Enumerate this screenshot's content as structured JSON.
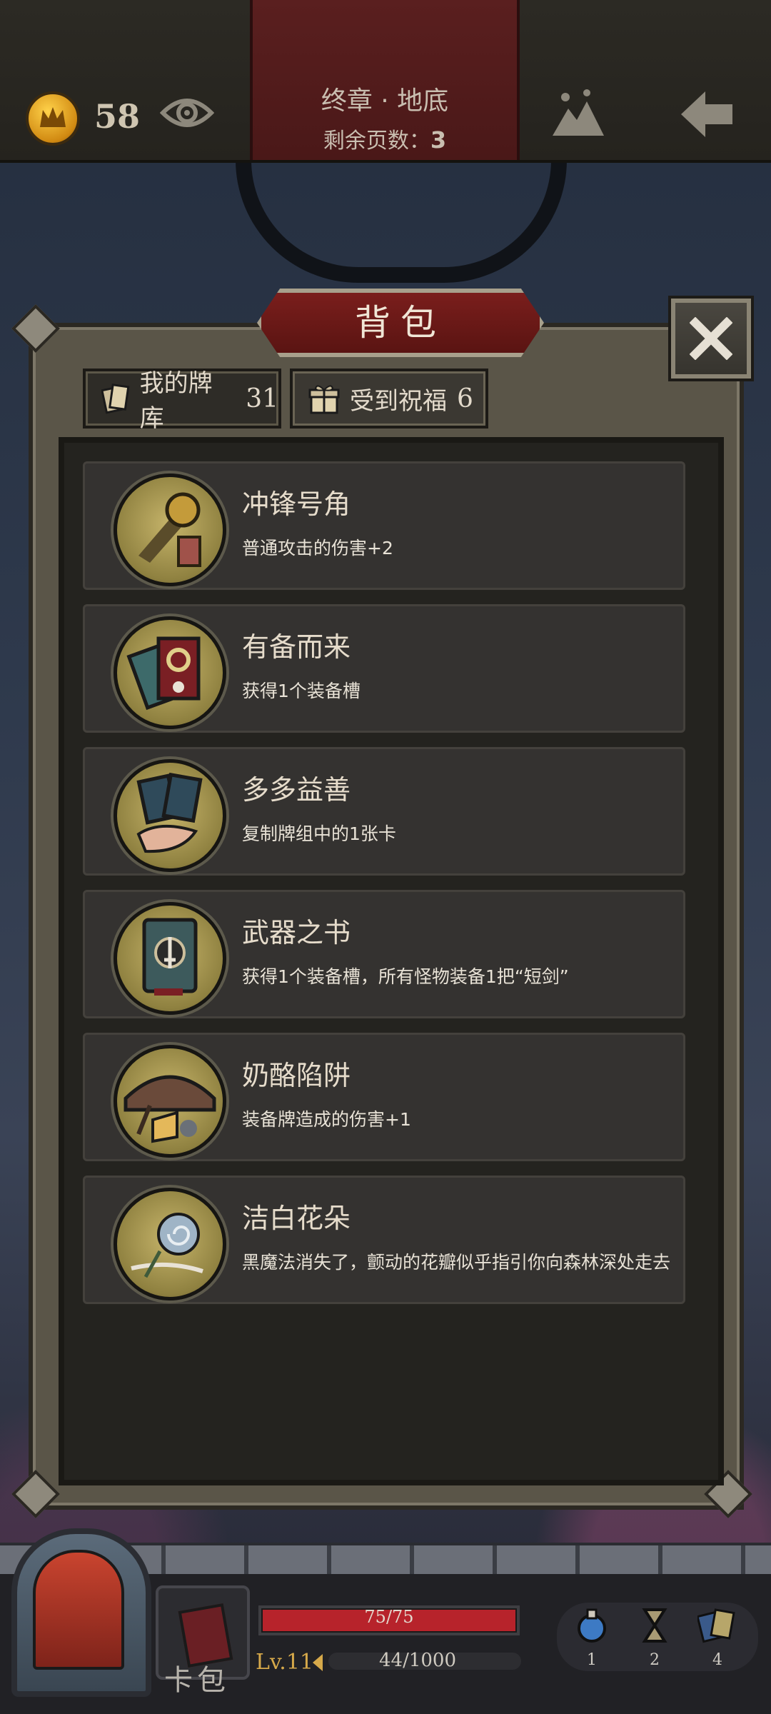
{
  "topbar": {
    "coins": "58",
    "chapter_title": "终章 · 地底",
    "pages_left_label": "剩余页数：",
    "pages_left_value": "3"
  },
  "panel": {
    "title": "背包",
    "tabs": [
      {
        "label": "我的牌库",
        "count": "31",
        "active": false
      },
      {
        "label": "受到祝福",
        "count": "6",
        "active": true
      }
    ]
  },
  "blessings": [
    {
      "name": "冲锋号角",
      "desc": "普通攻击的伤害+2",
      "icon": "horn-icon"
    },
    {
      "name": "有备而来",
      "desc": "获得1个装备槽",
      "icon": "equipment-card-icon"
    },
    {
      "name": "多多益善",
      "desc": "复制牌组中的1张卡",
      "icon": "duplicate-cards-icon"
    },
    {
      "name": "武器之书",
      "desc": "获得1个装备槽，所有怪物装备1把“短剑”",
      "icon": "weapon-book-icon"
    },
    {
      "name": "奶酪陷阱",
      "desc": "装备牌造成的伤害+1",
      "icon": "cheese-trap-icon"
    },
    {
      "name": "洁白花朵",
      "desc": "黑魔法消失了，颤动的花瓣似乎指引你向森林深处走去",
      "icon": "white-flower-icon"
    }
  ],
  "hud": {
    "deck_label": "卡包",
    "hp_text": "75/75",
    "hp_fraction": 1.0,
    "level": "Lv.11",
    "xp_text": "44/1000",
    "xp_fraction": 0.044,
    "consumables": [
      {
        "icon": "potion-icon",
        "count": "1"
      },
      {
        "icon": "hourglass-icon",
        "count": "2"
      },
      {
        "icon": "cards-icon",
        "count": "4"
      }
    ]
  },
  "colors": {
    "accent_red": "#b7232b",
    "gold": "#d6a94a",
    "panel_bg": "#24231f"
  }
}
